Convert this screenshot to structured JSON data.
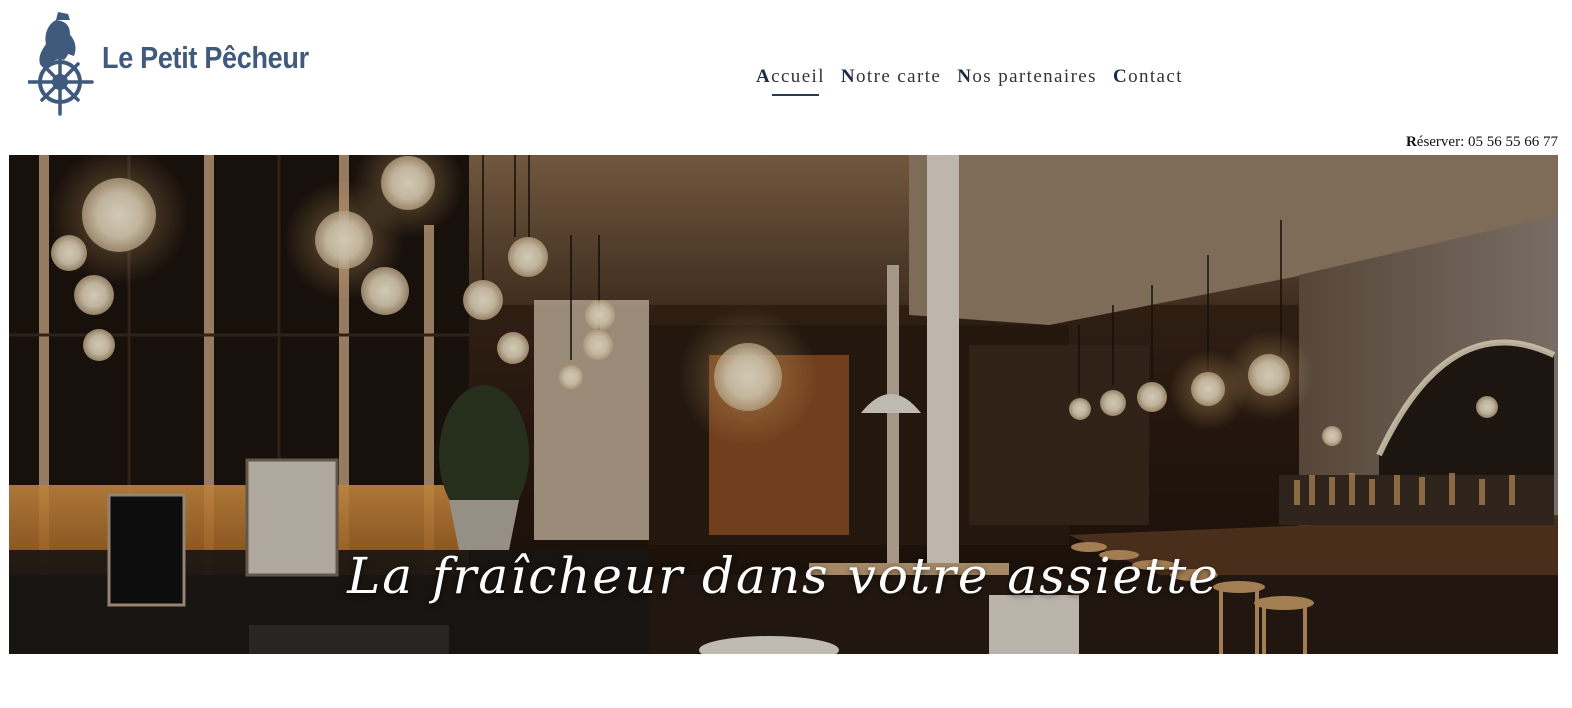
{
  "brand": {
    "name": "Le Petit Pêcheur",
    "logo_icon": "fisherman-helm-icon",
    "color": "#3f5a7c"
  },
  "nav": {
    "items": [
      {
        "cap": "A",
        "rest": "ccueil",
        "active": true
      },
      {
        "cap": "N",
        "rest": "otre carte",
        "active": false
      },
      {
        "cap": "N",
        "rest": "os partenaires",
        "active": false
      },
      {
        "cap": "C",
        "rest": "ontact",
        "active": false
      }
    ]
  },
  "reserve": {
    "cap": "R",
    "rest": "éserver:",
    "phone": "05 56 55 66 77"
  },
  "hero": {
    "tagline": "La fraîcheur dans votre assiette",
    "image": "restaurant-interior-photo"
  }
}
